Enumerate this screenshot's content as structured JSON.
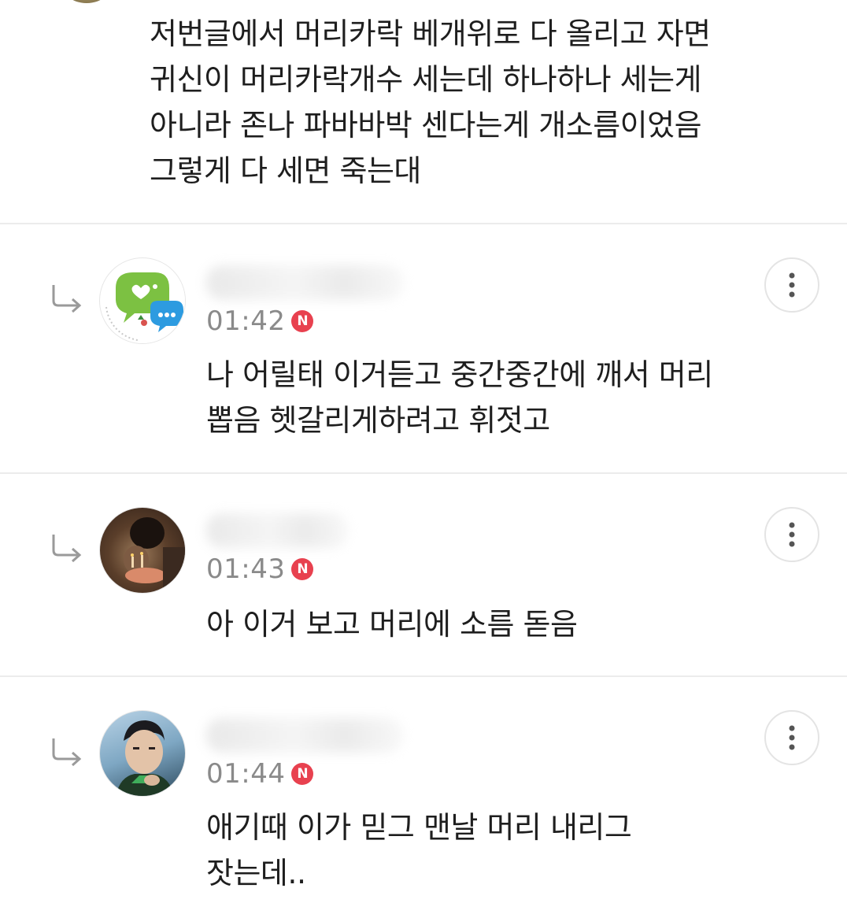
{
  "top_comment": {
    "lines": [
      "저번글에서 머리카락 베개위로 다 올리고 자면",
      "귀신이 머리카락개수 세는데 하나하나 세는게",
      "아니라 존나 파바바박 센다는게 개소름이었음",
      "그렇게 다 세면 죽는대"
    ]
  },
  "replies": [
    {
      "time": "01:42",
      "badge": "N",
      "avatar_icon": "cafe-logo-avatar",
      "lines": [
        "나 어릴태 이거듣고 중간중간에 깨서 머리",
        "뽑음 헷갈리게하려고 휘젓고"
      ]
    },
    {
      "time": "01:43",
      "badge": "N",
      "avatar_icon": "photo-avatar",
      "lines": [
        "아 이거 보고 머리에 소름 돋음"
      ]
    },
    {
      "time": "01:44",
      "badge": "N",
      "avatar_icon": "photo-avatar",
      "lines": [
        "애기때 이가 믿그 맨날 머리 내리그",
        "잣는데.."
      ]
    }
  ],
  "colors": {
    "badge": "#e8414f",
    "time": "#8a8a8a",
    "divider": "#ececec",
    "text": "#1e1e1e"
  },
  "icons": {
    "reply": "reply-arrow-icon",
    "more": "more-vertical-icon"
  }
}
